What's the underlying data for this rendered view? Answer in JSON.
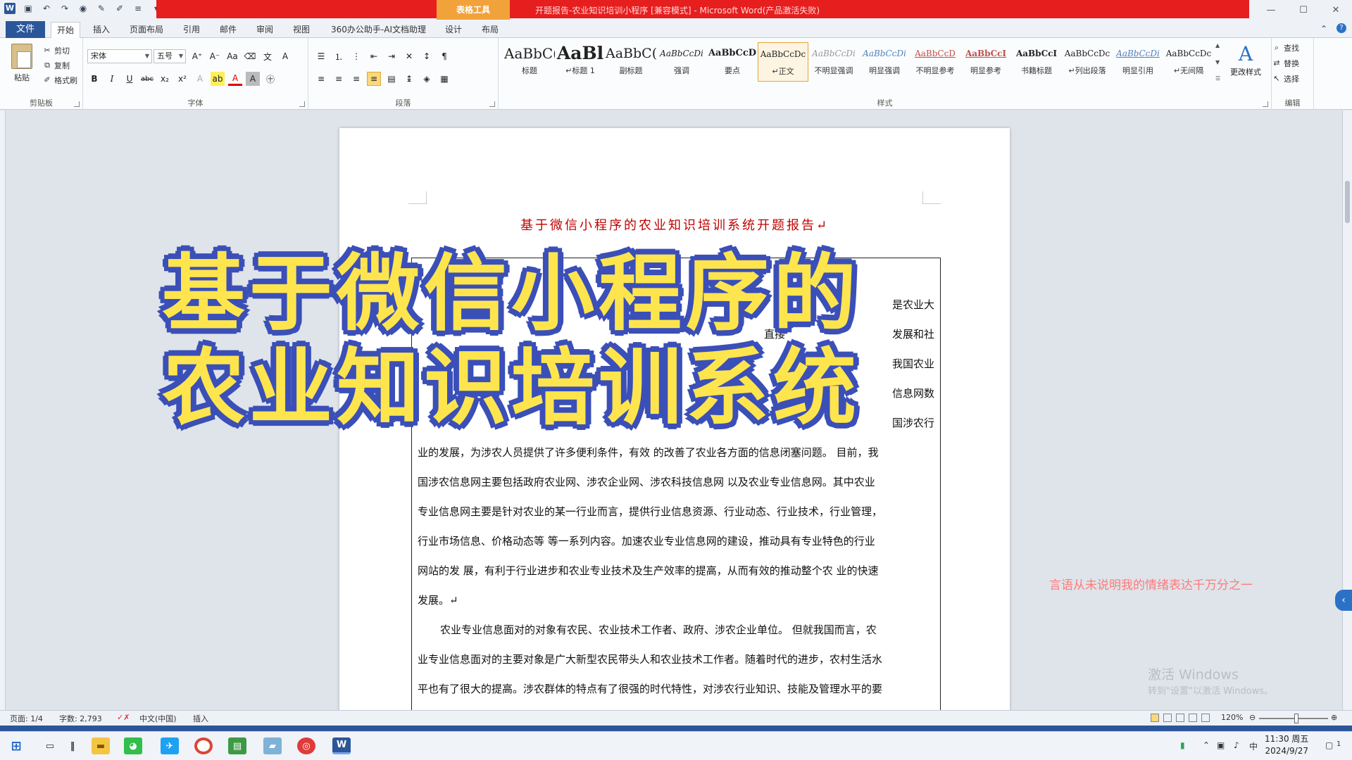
{
  "titlebar": {
    "context_tab": "表格工具",
    "window_title": "开题报告-农业知识培训小程序 [兼容模式] - Microsoft Word(产品激活失败)",
    "controls": [
      "—",
      "☐",
      "✕"
    ]
  },
  "tabs": {
    "file": "文件",
    "items": [
      "开始",
      "插入",
      "页面布局",
      "引用",
      "邮件",
      "审阅",
      "视图",
      "360办公助手-AI文档助理",
      "设计",
      "布局"
    ]
  },
  "ribbon": {
    "clipboard": {
      "paste": "粘贴",
      "cut": "剪切",
      "copy": "复制",
      "format_painter": "格式刷",
      "label": "剪贴板"
    },
    "font": {
      "font_name": "宋体",
      "font_size": "五号",
      "label": "字体"
    },
    "paragraph": {
      "label": "段落"
    },
    "styles": {
      "label": "样式",
      "items": [
        {
          "preview": "AaBbC(",
          "name": "标题"
        },
        {
          "preview": "AaBl",
          "name": "↵标题 1"
        },
        {
          "preview": "AaBbC(",
          "name": "副标题"
        },
        {
          "preview": "AaBbCcDi",
          "name": "强调"
        },
        {
          "preview": "AaBbCcD",
          "name": "要点"
        },
        {
          "preview": "AaBbCcDc",
          "name": "↵正文"
        },
        {
          "preview": "AaBbCcDi",
          "name": "不明显强调"
        },
        {
          "preview": "AaBbCcDi",
          "name": "明显强调"
        },
        {
          "preview": "AaBbCcD",
          "name": "不明显参考"
        },
        {
          "preview": "AaBbCcI",
          "name": "明显参考"
        },
        {
          "preview": "AaBbCcI",
          "name": "书籍标题"
        },
        {
          "preview": "AaBbCcDc",
          "name": "↵列出段落"
        },
        {
          "preview": "AaBbCcDi",
          "name": "明显引用"
        },
        {
          "preview": "AaBbCcDc",
          "name": "↵无间隔"
        }
      ],
      "change_styles": "更改样式"
    },
    "editing": {
      "find": "查找",
      "replace": "替换",
      "select": "选择",
      "label": "编辑"
    }
  },
  "document": {
    "title": "基于微信小程序的农业知识培训系统开题报告↵",
    "lines": [
      "是农业大",
      "发展和社",
      "我国农业",
      "信息网数",
      "国涉农行",
      "业的发展，为涉农人员提供了许多便利条件，有效 的改善了农业各方面的信息闭塞问题。 目前，我",
      "国涉农信息网主要包括政府农业网、涉农企业网、涉农科技信息网 以及农业专业信息网。其中农业",
      "专业信息网主要是针对农业的某一行业而言，提供行业信息资源、行业动态、行业技术，行业管理，",
      "行业市场信息、价格动态等 等一系列内容。加速农业专业信息网的建设，推动具有专业特色的行业",
      "网站的发 展，有利于行业进步和农业专业技术及生产效率的提高，从而有效的推动整个农 业的快速",
      "发展。↵",
      "农业专业信息面对的对象有农民、农业技术工作者、政府、涉农企业单位。 但就我国而言，农",
      "业专业信息面对的主要对象是广大新型农民带头人和农业技术工作者。随着时代的进步，农村生活水",
      "平也有了很大的提高。涉农群体的特点有了很强的时代特性，对涉农行业知识、技能及管理水平的要"
    ],
    "partial_words": [
      "直接",
      "很大"
    ]
  },
  "overlay": {
    "line1": "基于微信小程序的",
    "line2": "农业知识培训系统"
  },
  "side_note": "言语从未说明我的情绪表达千万分之一",
  "watermark": {
    "line1": "激活 Windows",
    "line2": "转到\"设置\"以激活 Windows。"
  },
  "statusbar": {
    "page": "页面: 1/4",
    "words": "字数: 2,793",
    "language": "中文(中国)",
    "mode": "插入",
    "zoom": "120%"
  },
  "taskbar": {
    "ime": "中",
    "time": "11:30 周五",
    "date": "2024/9/27",
    "notif_count": "1"
  },
  "colors": {
    "accent": "#2b579a",
    "title_band": "#e61e1e",
    "context_tab": "#f2a23a",
    "doc_title": "#c00000",
    "overlay_fill": "#ffe54d",
    "overlay_stroke": "#3b4fb8"
  }
}
